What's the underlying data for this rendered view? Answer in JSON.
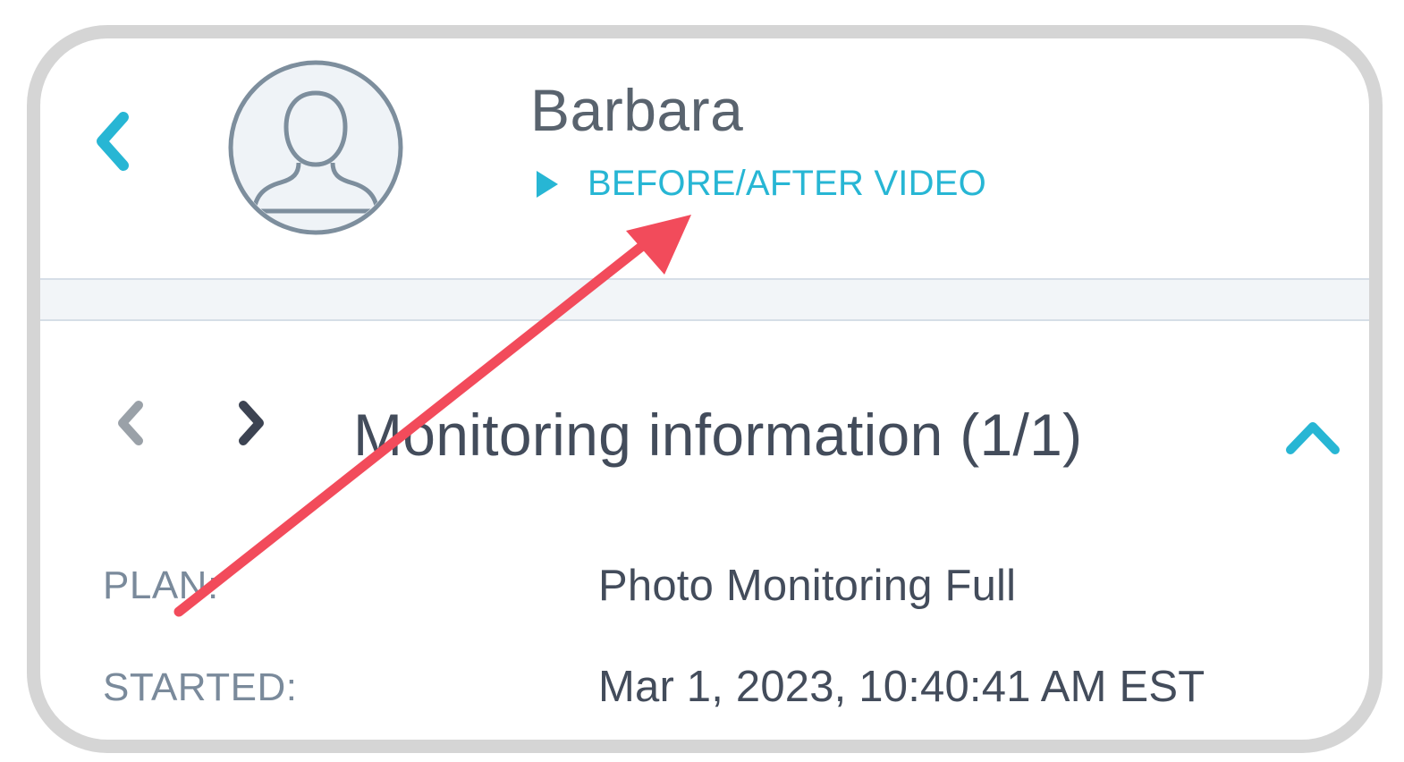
{
  "profile": {
    "name": "Barbara",
    "video_link_label": "BEFORE/AFTER VIDEO"
  },
  "icons": {
    "back": "chevron-left-icon",
    "avatar": "user-avatar-icon",
    "play": "play-triangle-icon",
    "prev": "chevron-left-icon",
    "next": "chevron-right-icon",
    "collapse": "chevron-up-icon",
    "annotation": "red-arrow-annotation"
  },
  "monitoring": {
    "title": "Monitoring information (1/1)",
    "rows": [
      {
        "label": "PLAN:",
        "value": "Photo Monitoring Full"
      },
      {
        "label": "STARTED:",
        "value": "Mar 1, 2023, 10:40:41 AM EST"
      }
    ]
  },
  "colors": {
    "accent": "#27b6d4",
    "text_dark": "#434c5b",
    "text_muted": "#7a8a9b",
    "annotation": "#f24b5b",
    "frame": "#d5d5d5"
  }
}
